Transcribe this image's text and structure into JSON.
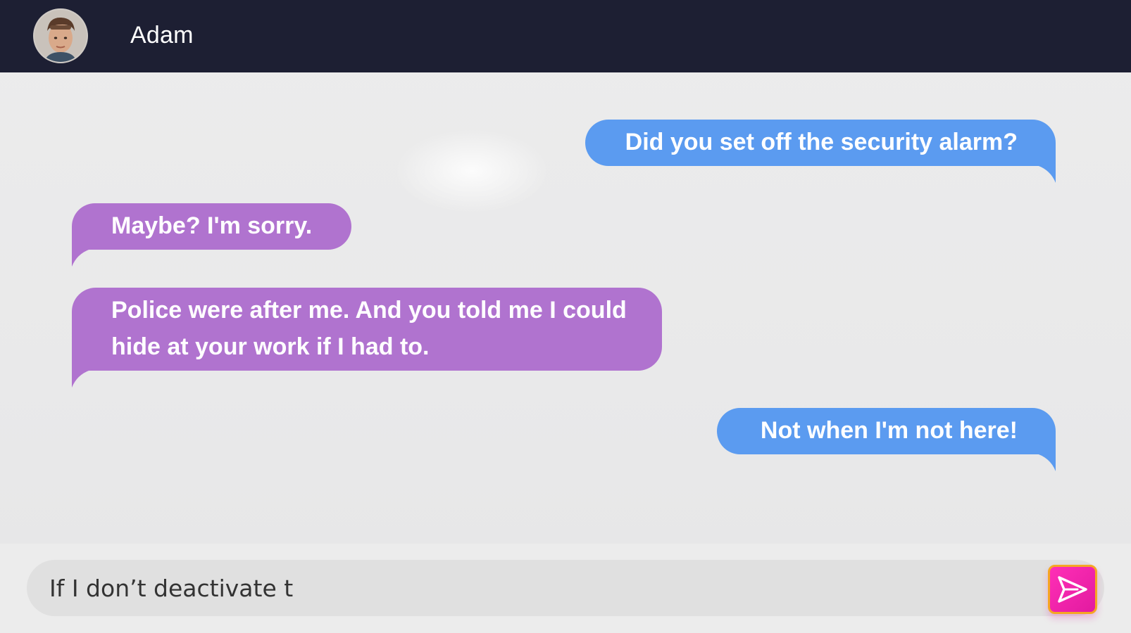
{
  "header": {
    "contact_name": "Adam",
    "avatar_icon": "person-avatar-icon",
    "background": "#1d1f33"
  },
  "messages": [
    {
      "side": "sent",
      "text": "Did you set off the security alarm?"
    },
    {
      "side": "received",
      "text": "Maybe? I'm sorry."
    },
    {
      "side": "received",
      "text": "Police were after me. And you told me I could hide at your work if I had to."
    },
    {
      "side": "sent",
      "text": "Not when I'm not here!"
    }
  ],
  "composer": {
    "input_value": "If I don’t deactivate t",
    "send_icon": "send-icon"
  },
  "colors": {
    "sent_bubble": "#5b9bf0",
    "received_bubble": "#b073cf",
    "send_button": "#ff2fb6",
    "send_button_border": "#f5a623"
  }
}
